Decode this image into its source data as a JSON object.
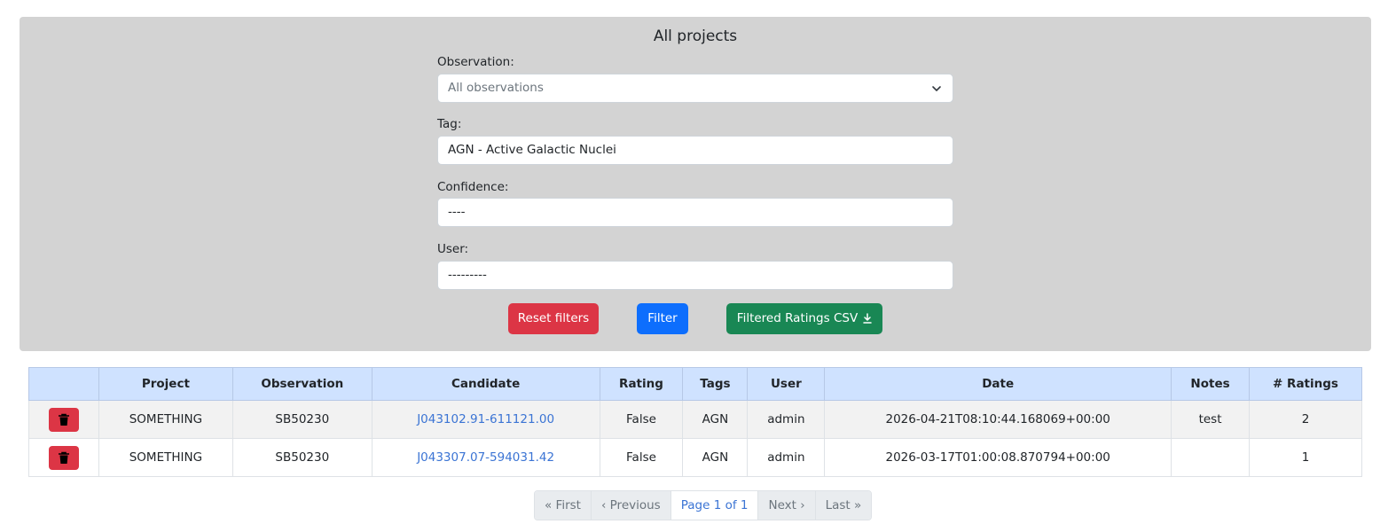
{
  "panel": {
    "title": "All projects",
    "observation_label": "Observation:",
    "observation_value": "All observations",
    "tag_label": "Tag:",
    "tag_value": "AGN - Active Galactic Nuclei",
    "confidence_label": "Confidence:",
    "confidence_value": "----",
    "user_label": "User:",
    "user_value": "---------",
    "reset_label": "Reset filters",
    "filter_label": "Filter",
    "csv_label": "Filtered Ratings CSV"
  },
  "table": {
    "headers": [
      "",
      "Project",
      "Observation",
      "Candidate",
      "Rating",
      "Tags",
      "User",
      "Date",
      "Notes",
      "# Ratings"
    ],
    "rows": [
      {
        "project": "SOMETHING",
        "observation": "SB50230",
        "candidate": "J043102.91-611121.00",
        "rating": "False",
        "tags": "AGN",
        "user": "admin",
        "date": "2026-04-21T08:10:44.168069+00:00",
        "notes": "test",
        "num_ratings": "2"
      },
      {
        "project": "SOMETHING",
        "observation": "SB50230",
        "candidate": "J043307.07-594031.42",
        "rating": "False",
        "tags": "AGN",
        "user": "admin",
        "date": "2026-03-17T01:00:08.870794+00:00",
        "notes": "",
        "num_ratings": "1"
      }
    ]
  },
  "pagination": {
    "first": "« First",
    "previous": "‹ Previous",
    "current": "Page 1 of 1",
    "next": "Next ›",
    "last": "Last »"
  },
  "colors": {
    "panel_bg": "#d3d3d3",
    "header_bg": "#cfe2ff",
    "danger": "#dc3545",
    "primary": "#0d6efd",
    "success": "#198754",
    "link": "#3b74d4"
  },
  "icons": {
    "select_arrow": "chevron-down-icon",
    "csv": "download-icon",
    "delete": "trash-icon"
  }
}
